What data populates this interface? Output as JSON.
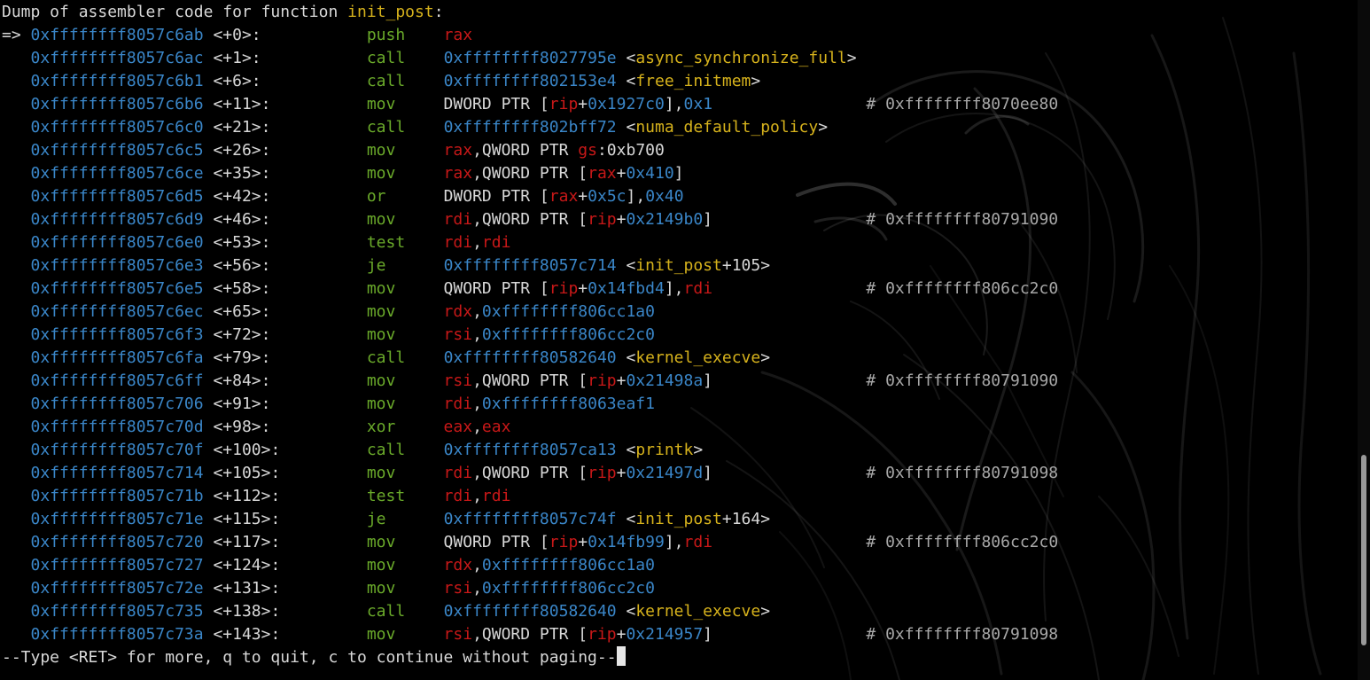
{
  "colors": {
    "background": "#000000",
    "default": "#d8d8d8",
    "address": "#3a86c8",
    "function": "#d6b21c",
    "mnemonic": "#6aaa2a",
    "register": "#c81818",
    "number": "#3a86c8",
    "comment": "#a8a8a8",
    "cursor": "#e6e6e6",
    "scrollbar_thumb": "#9a9a9a"
  },
  "terminal": {
    "header": [
      {
        "t": "Dump of assembler code for function ",
        "c": "default"
      },
      {
        "t": "init_post",
        "c": "function"
      },
      {
        "t": ":",
        "c": "default"
      }
    ],
    "rows": [
      {
        "marker": "=> ",
        "addr": "0xffffffff8057c6ab",
        "offset": "<+0>:",
        "mnemonic": "push",
        "operands": [
          {
            "t": "rax",
            "c": "register"
          }
        ],
        "comment": ""
      },
      {
        "marker": "   ",
        "addr": "0xffffffff8057c6ac",
        "offset": "<+1>:",
        "mnemonic": "call",
        "operands": [
          {
            "t": "0xffffffff8027795e",
            "c": "address"
          },
          {
            "t": " <",
            "c": "default"
          },
          {
            "t": "async_synchronize_full",
            "c": "function"
          },
          {
            "t": ">",
            "c": "default"
          }
        ],
        "comment": ""
      },
      {
        "marker": "   ",
        "addr": "0xffffffff8057c6b1",
        "offset": "<+6>:",
        "mnemonic": "call",
        "operands": [
          {
            "t": "0xffffffff802153e4",
            "c": "address"
          },
          {
            "t": " <",
            "c": "default"
          },
          {
            "t": "free_initmem",
            "c": "function"
          },
          {
            "t": ">",
            "c": "default"
          }
        ],
        "comment": ""
      },
      {
        "marker": "   ",
        "addr": "0xffffffff8057c6b6",
        "offset": "<+11>:",
        "mnemonic": "mov",
        "operands": [
          {
            "t": "DWORD PTR [",
            "c": "default"
          },
          {
            "t": "rip",
            "c": "register"
          },
          {
            "t": "+",
            "c": "default"
          },
          {
            "t": "0x1927c0",
            "c": "number"
          },
          {
            "t": "],",
            "c": "default"
          },
          {
            "t": "0x1",
            "c": "number"
          }
        ],
        "comment": "# 0xffffffff8070ee80"
      },
      {
        "marker": "   ",
        "addr": "0xffffffff8057c6c0",
        "offset": "<+21>:",
        "mnemonic": "call",
        "operands": [
          {
            "t": "0xffffffff802bff72",
            "c": "address"
          },
          {
            "t": " <",
            "c": "default"
          },
          {
            "t": "numa_default_policy",
            "c": "function"
          },
          {
            "t": ">",
            "c": "default"
          }
        ],
        "comment": ""
      },
      {
        "marker": "   ",
        "addr": "0xffffffff8057c6c5",
        "offset": "<+26>:",
        "mnemonic": "mov",
        "operands": [
          {
            "t": "rax",
            "c": "register"
          },
          {
            "t": ",QWORD PTR ",
            "c": "default"
          },
          {
            "t": "gs",
            "c": "register"
          },
          {
            "t": ":0xb700",
            "c": "default"
          }
        ],
        "comment": ""
      },
      {
        "marker": "   ",
        "addr": "0xffffffff8057c6ce",
        "offset": "<+35>:",
        "mnemonic": "mov",
        "operands": [
          {
            "t": "rax",
            "c": "register"
          },
          {
            "t": ",QWORD PTR [",
            "c": "default"
          },
          {
            "t": "rax",
            "c": "register"
          },
          {
            "t": "+",
            "c": "default"
          },
          {
            "t": "0x410",
            "c": "number"
          },
          {
            "t": "]",
            "c": "default"
          }
        ],
        "comment": ""
      },
      {
        "marker": "   ",
        "addr": "0xffffffff8057c6d5",
        "offset": "<+42>:",
        "mnemonic": "or",
        "operands": [
          {
            "t": "DWORD PTR [",
            "c": "default"
          },
          {
            "t": "rax",
            "c": "register"
          },
          {
            "t": "+",
            "c": "default"
          },
          {
            "t": "0x5c",
            "c": "number"
          },
          {
            "t": "],",
            "c": "default"
          },
          {
            "t": "0x40",
            "c": "number"
          }
        ],
        "comment": ""
      },
      {
        "marker": "   ",
        "addr": "0xffffffff8057c6d9",
        "offset": "<+46>:",
        "mnemonic": "mov",
        "operands": [
          {
            "t": "rdi",
            "c": "register"
          },
          {
            "t": ",QWORD PTR [",
            "c": "default"
          },
          {
            "t": "rip",
            "c": "register"
          },
          {
            "t": "+",
            "c": "default"
          },
          {
            "t": "0x2149b0",
            "c": "number"
          },
          {
            "t": "]",
            "c": "default"
          }
        ],
        "comment": "# 0xffffffff80791090"
      },
      {
        "marker": "   ",
        "addr": "0xffffffff8057c6e0",
        "offset": "<+53>:",
        "mnemonic": "test",
        "operands": [
          {
            "t": "rdi",
            "c": "register"
          },
          {
            "t": ",",
            "c": "default"
          },
          {
            "t": "rdi",
            "c": "register"
          }
        ],
        "comment": ""
      },
      {
        "marker": "   ",
        "addr": "0xffffffff8057c6e3",
        "offset": "<+56>:",
        "mnemonic": "je",
        "operands": [
          {
            "t": "0xffffffff8057c714",
            "c": "address"
          },
          {
            "t": " <",
            "c": "default"
          },
          {
            "t": "init_post",
            "c": "function"
          },
          {
            "t": "+105>",
            "c": "default"
          }
        ],
        "comment": ""
      },
      {
        "marker": "   ",
        "addr": "0xffffffff8057c6e5",
        "offset": "<+58>:",
        "mnemonic": "mov",
        "operands": [
          {
            "t": "QWORD PTR [",
            "c": "default"
          },
          {
            "t": "rip",
            "c": "register"
          },
          {
            "t": "+",
            "c": "default"
          },
          {
            "t": "0x14fbd4",
            "c": "number"
          },
          {
            "t": "],",
            "c": "default"
          },
          {
            "t": "rdi",
            "c": "register"
          }
        ],
        "comment": "# 0xffffffff806cc2c0"
      },
      {
        "marker": "   ",
        "addr": "0xffffffff8057c6ec",
        "offset": "<+65>:",
        "mnemonic": "mov",
        "operands": [
          {
            "t": "rdx",
            "c": "register"
          },
          {
            "t": ",",
            "c": "default"
          },
          {
            "t": "0xffffffff806cc1a0",
            "c": "number"
          }
        ],
        "comment": ""
      },
      {
        "marker": "   ",
        "addr": "0xffffffff8057c6f3",
        "offset": "<+72>:",
        "mnemonic": "mov",
        "operands": [
          {
            "t": "rsi",
            "c": "register"
          },
          {
            "t": ",",
            "c": "default"
          },
          {
            "t": "0xffffffff806cc2c0",
            "c": "number"
          }
        ],
        "comment": ""
      },
      {
        "marker": "   ",
        "addr": "0xffffffff8057c6fa",
        "offset": "<+79>:",
        "mnemonic": "call",
        "operands": [
          {
            "t": "0xffffffff80582640",
            "c": "address"
          },
          {
            "t": " <",
            "c": "default"
          },
          {
            "t": "kernel_execve",
            "c": "function"
          },
          {
            "t": ">",
            "c": "default"
          }
        ],
        "comment": ""
      },
      {
        "marker": "   ",
        "addr": "0xffffffff8057c6ff",
        "offset": "<+84>:",
        "mnemonic": "mov",
        "operands": [
          {
            "t": "rsi",
            "c": "register"
          },
          {
            "t": ",QWORD PTR [",
            "c": "default"
          },
          {
            "t": "rip",
            "c": "register"
          },
          {
            "t": "+",
            "c": "default"
          },
          {
            "t": "0x21498a",
            "c": "number"
          },
          {
            "t": "]",
            "c": "default"
          }
        ],
        "comment": "# 0xffffffff80791090"
      },
      {
        "marker": "   ",
        "addr": "0xffffffff8057c706",
        "offset": "<+91>:",
        "mnemonic": "mov",
        "operands": [
          {
            "t": "rdi",
            "c": "register"
          },
          {
            "t": ",",
            "c": "default"
          },
          {
            "t": "0xffffffff8063eaf1",
            "c": "number"
          }
        ],
        "comment": ""
      },
      {
        "marker": "   ",
        "addr": "0xffffffff8057c70d",
        "offset": "<+98>:",
        "mnemonic": "xor",
        "operands": [
          {
            "t": "eax",
            "c": "register"
          },
          {
            "t": ",",
            "c": "default"
          },
          {
            "t": "eax",
            "c": "register"
          }
        ],
        "comment": ""
      },
      {
        "marker": "   ",
        "addr": "0xffffffff8057c70f",
        "offset": "<+100>:",
        "mnemonic": "call",
        "operands": [
          {
            "t": "0xffffffff8057ca13",
            "c": "address"
          },
          {
            "t": " <",
            "c": "default"
          },
          {
            "t": "printk",
            "c": "function"
          },
          {
            "t": ">",
            "c": "default"
          }
        ],
        "comment": ""
      },
      {
        "marker": "   ",
        "addr": "0xffffffff8057c714",
        "offset": "<+105>:",
        "mnemonic": "mov",
        "operands": [
          {
            "t": "rdi",
            "c": "register"
          },
          {
            "t": ",QWORD PTR [",
            "c": "default"
          },
          {
            "t": "rip",
            "c": "register"
          },
          {
            "t": "+",
            "c": "default"
          },
          {
            "t": "0x21497d",
            "c": "number"
          },
          {
            "t": "]",
            "c": "default"
          }
        ],
        "comment": "# 0xffffffff80791098"
      },
      {
        "marker": "   ",
        "addr": "0xffffffff8057c71b",
        "offset": "<+112>:",
        "mnemonic": "test",
        "operands": [
          {
            "t": "rdi",
            "c": "register"
          },
          {
            "t": ",",
            "c": "default"
          },
          {
            "t": "rdi",
            "c": "register"
          }
        ],
        "comment": ""
      },
      {
        "marker": "   ",
        "addr": "0xffffffff8057c71e",
        "offset": "<+115>:",
        "mnemonic": "je",
        "operands": [
          {
            "t": "0xffffffff8057c74f",
            "c": "address"
          },
          {
            "t": " <",
            "c": "default"
          },
          {
            "t": "init_post",
            "c": "function"
          },
          {
            "t": "+164>",
            "c": "default"
          }
        ],
        "comment": ""
      },
      {
        "marker": "   ",
        "addr": "0xffffffff8057c720",
        "offset": "<+117>:",
        "mnemonic": "mov",
        "operands": [
          {
            "t": "QWORD PTR [",
            "c": "default"
          },
          {
            "t": "rip",
            "c": "register"
          },
          {
            "t": "+",
            "c": "default"
          },
          {
            "t": "0x14fb99",
            "c": "number"
          },
          {
            "t": "],",
            "c": "default"
          },
          {
            "t": "rdi",
            "c": "register"
          }
        ],
        "comment": "# 0xffffffff806cc2c0"
      },
      {
        "marker": "   ",
        "addr": "0xffffffff8057c727",
        "offset": "<+124>:",
        "mnemonic": "mov",
        "operands": [
          {
            "t": "rdx",
            "c": "register"
          },
          {
            "t": ",",
            "c": "default"
          },
          {
            "t": "0xffffffff806cc1a0",
            "c": "number"
          }
        ],
        "comment": ""
      },
      {
        "marker": "   ",
        "addr": "0xffffffff8057c72e",
        "offset": "<+131>:",
        "mnemonic": "mov",
        "operands": [
          {
            "t": "rsi",
            "c": "register"
          },
          {
            "t": ",",
            "c": "default"
          },
          {
            "t": "0xffffffff806cc2c0",
            "c": "number"
          }
        ],
        "comment": ""
      },
      {
        "marker": "   ",
        "addr": "0xffffffff8057c735",
        "offset": "<+138>:",
        "mnemonic": "call",
        "operands": [
          {
            "t": "0xffffffff80582640",
            "c": "address"
          },
          {
            "t": " <",
            "c": "default"
          },
          {
            "t": "kernel_execve",
            "c": "function"
          },
          {
            "t": ">",
            "c": "default"
          }
        ],
        "comment": ""
      },
      {
        "marker": "   ",
        "addr": "0xffffffff8057c73a",
        "offset": "<+143>:",
        "mnemonic": "mov",
        "operands": [
          {
            "t": "rsi",
            "c": "register"
          },
          {
            "t": ",QWORD PTR [",
            "c": "default"
          },
          {
            "t": "rip",
            "c": "register"
          },
          {
            "t": "+",
            "c": "default"
          },
          {
            "t": "0x214957",
            "c": "number"
          },
          {
            "t": "]",
            "c": "default"
          }
        ],
        "comment": "# 0xffffffff80791098"
      }
    ],
    "pager_prompt": "--Type <RET> for more, q to quit, c to continue without paging--",
    "scroll_position": 0.93
  }
}
